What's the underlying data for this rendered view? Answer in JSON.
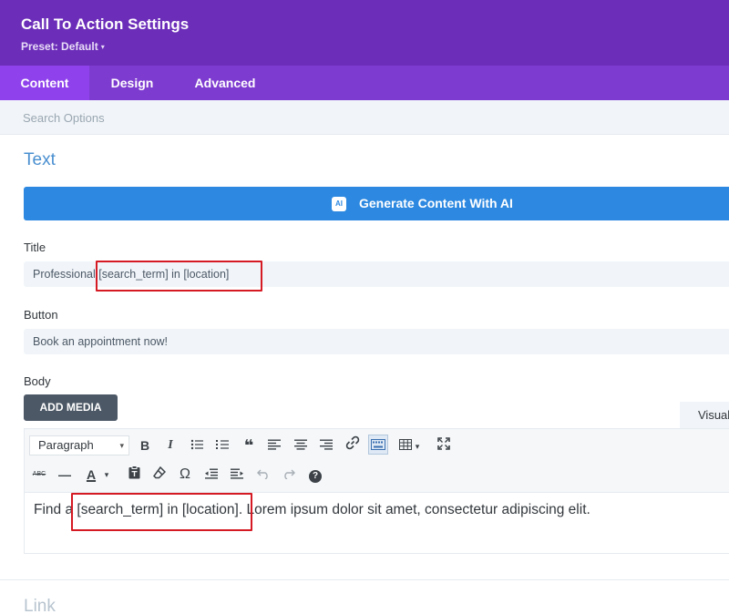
{
  "header": {
    "title": "Call To Action Settings",
    "preset_label": "Preset: Default",
    "preset_caret": "▾"
  },
  "tabs": [
    {
      "label": "Content",
      "active": true
    },
    {
      "label": "Design",
      "active": false
    },
    {
      "label": "Advanced",
      "active": false
    }
  ],
  "search": {
    "placeholder": "Search Options",
    "value": ""
  },
  "sections": {
    "text_title": "Text",
    "link_title": "Link"
  },
  "ai_button": {
    "icon_text": "AI",
    "label": "Generate Content With AI"
  },
  "fields": {
    "title_label": "Title",
    "title_value": "Professional [search_term] in [location]",
    "button_label": "Button",
    "button_value": "Book an appointment now!",
    "body_label": "Body"
  },
  "editor": {
    "add_media_label": "ADD MEDIA",
    "visual_tab_label": "Visual",
    "format_select": "Paragraph",
    "format_caret": "▾",
    "body_text": "Find a [search_term] in [location]. Lorem ipsum dolor sit amet, consectetur adipiscing elit."
  },
  "toolbar_icons": {
    "bold": "B",
    "italic": "I",
    "blockquote": "❝",
    "table_caret": "▾",
    "strikethrough": "ABC",
    "horizontal_rule": "—",
    "text_color": "A",
    "text_color_caret": "▾",
    "special_char": "Ω",
    "help": "?"
  },
  "colors": {
    "header_bg": "#6c2eb9",
    "tabs_bg": "#7e3bd0",
    "active_tab_bg": "#8f42ec",
    "ai_button_bg": "#2c88e0",
    "section_title": "#4a8fd0",
    "highlight_border": "#d61a24"
  }
}
